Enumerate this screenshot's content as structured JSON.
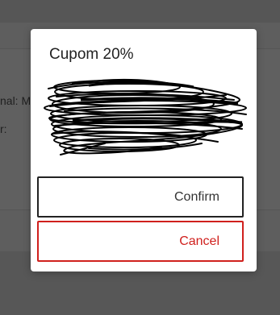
{
  "background": {
    "partial_text_1": "nal: M",
    "partial_text_2": "r:"
  },
  "modal": {
    "title": "Cupom 20%",
    "confirm_label": "Confirm",
    "cancel_label": "Cancel"
  },
  "colors": {
    "overlay": "#5e5e5e",
    "modal_bg": "#ffffff",
    "confirm_border": "#222222",
    "cancel_accent": "#d0201d",
    "scribble": "#000000"
  }
}
